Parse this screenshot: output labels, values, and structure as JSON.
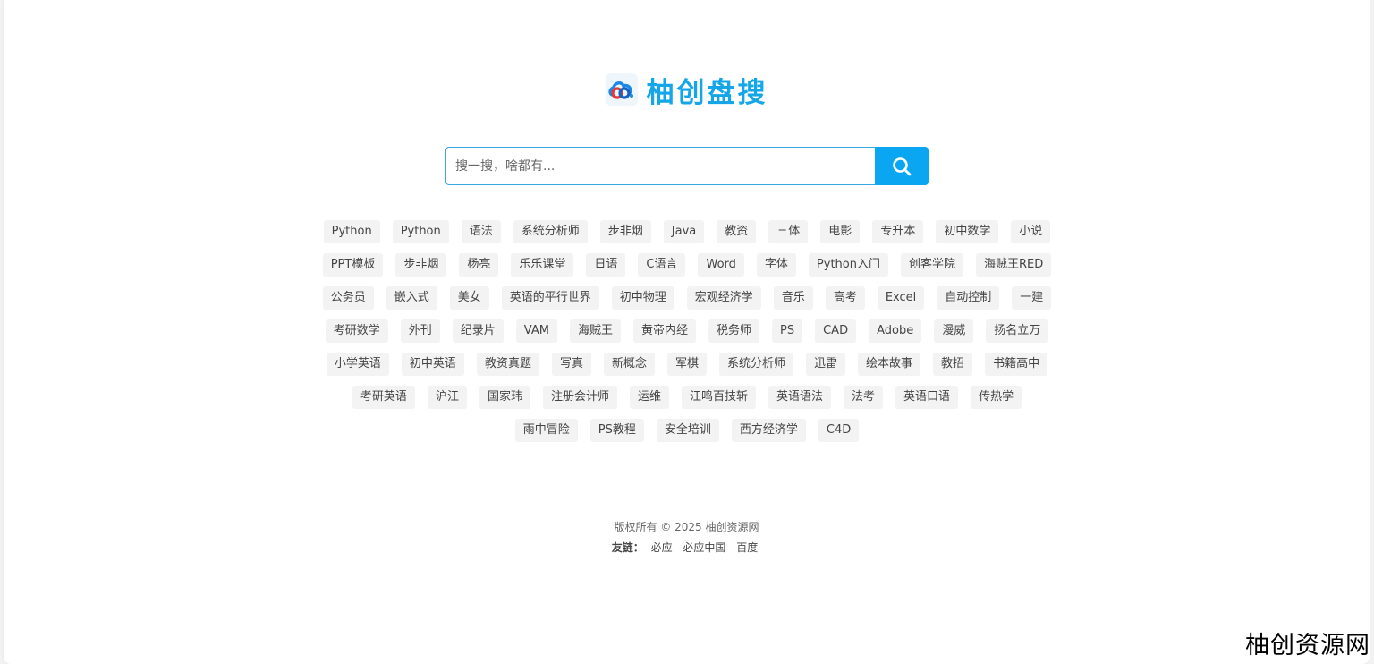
{
  "brand": {
    "name": "柚创盘搜",
    "color": "#14a6e8",
    "logo_icon": "cloud-link-logo-icon"
  },
  "search": {
    "placeholder": "搜一搜，啥都有...",
    "value": "",
    "button_icon": "search-icon",
    "button_color": "#0aa6f2"
  },
  "hot_tags": [
    "Python",
    "Python",
    "语法",
    "系统分析师",
    "步非烟",
    "Java",
    "教资",
    "三体",
    "电影",
    "专升本",
    "初中数学",
    "小说",
    "PPT模板",
    "步非烟",
    "杨亮",
    "乐乐课堂",
    "日语",
    "C语言",
    "Word",
    "字体",
    "Python入门",
    "创客学院",
    "海贼王RED",
    "公务员",
    "嵌入式",
    "美女",
    "英语的平行世界",
    "初中物理",
    "宏观经济学",
    "音乐",
    "高考",
    "Excel",
    "自动控制",
    "一建",
    "考研数学",
    "外刊",
    "纪录片",
    "VAM",
    "海贼王",
    "黄帝内经",
    "税务师",
    "PS",
    "CAD",
    "Adobe",
    "漫威",
    "扬名立万",
    "小学英语",
    "初中英语",
    "教资真题",
    "写真",
    "新概念",
    "军棋",
    "系统分析师",
    "迅雷",
    "绘本故事",
    "教招",
    "书籍高中",
    "考研英语",
    "沪江",
    "国家玮",
    "注册会计师",
    "运维",
    "江鸣百技斩",
    "英语语法",
    "法考",
    "英语口语",
    "传热学",
    "雨中冒险",
    "PS教程",
    "安全培训",
    "西方经济学",
    "C4D"
  ],
  "footer": {
    "copyright": "版权所有 © 2025 柚创资源网",
    "links_label": "友链：",
    "links": [
      "必应",
      "必应中国",
      "百度"
    ]
  },
  "watermark": "柚创资源网"
}
